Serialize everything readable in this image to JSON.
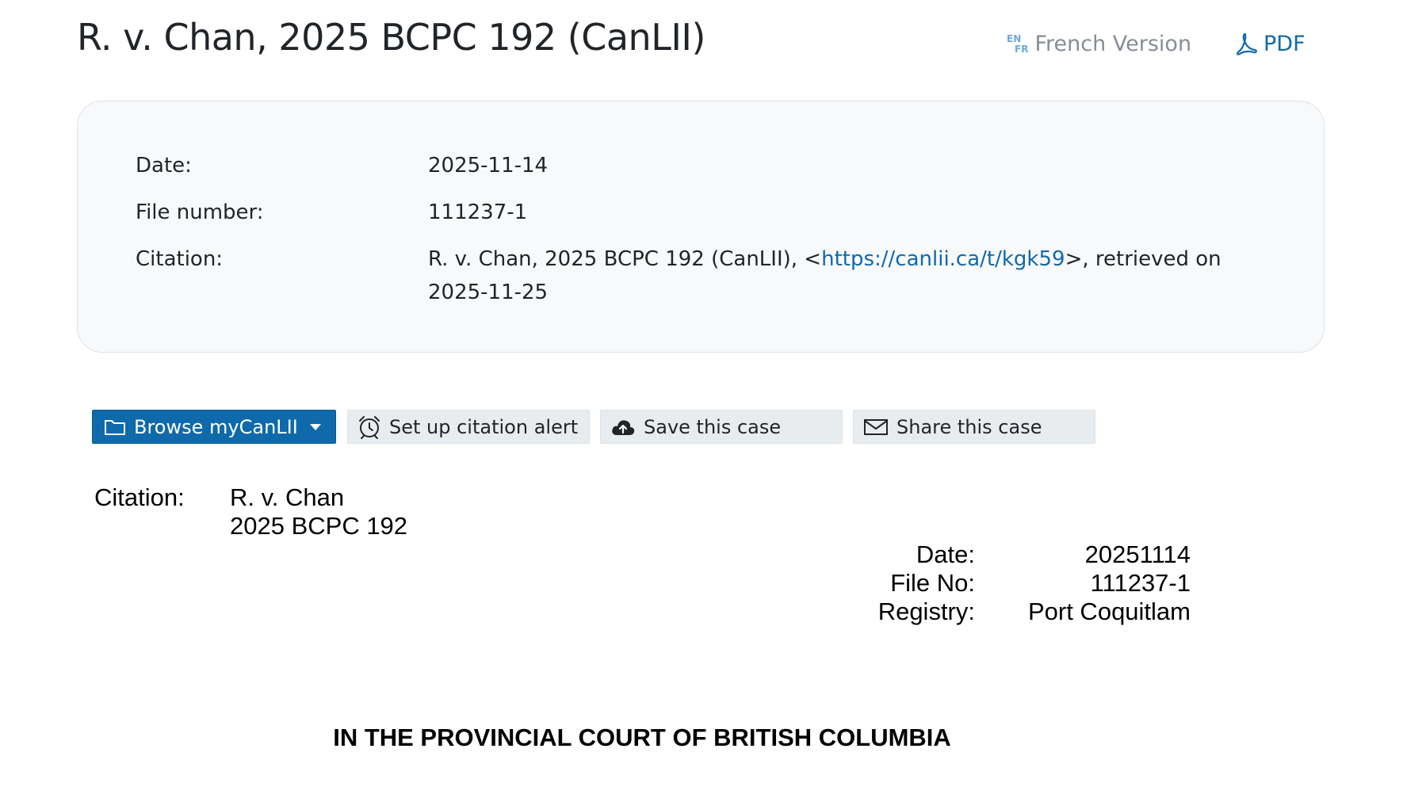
{
  "header": {
    "title": "R. v. Chan, 2025 BCPC 192 (CanLII)",
    "lang_badge_top": "EN",
    "lang_badge_bottom": "FR",
    "french_version_label": "French Version",
    "pdf_label": "PDF"
  },
  "metadata": {
    "date_label": "Date:",
    "date_value": "2025-11-14",
    "file_number_label": "File number:",
    "file_number_value": "111237-1",
    "citation_label": "Citation:",
    "citation_prefix": "R. v. Chan, 2025 BCPC 192 (CanLII), <",
    "citation_url": "https://canlii.ca/t/kgk59",
    "citation_suffix": ">, retrieved on 2025-11-25"
  },
  "toolbar": {
    "browse_label": "Browse myCanLII",
    "alert_label": "Set up citation alert",
    "save_label": "Save this case",
    "share_label": "Share this case"
  },
  "document": {
    "citation_label": "Citation:",
    "citation_name": "R. v. Chan",
    "citation_number": "2025 BCPC 192",
    "info": [
      {
        "label": "Date:",
        "value": "20251114"
      },
      {
        "label": "File No:",
        "value": "111237-1"
      },
      {
        "label": "Registry:",
        "value": "Port Coquitlam"
      }
    ],
    "court_heading": "IN THE PROVINCIAL COURT OF BRITISH COLUMBIA"
  },
  "colors": {
    "link": "#0f6aab",
    "primary_button": "#0f6aab",
    "secondary_button": "#e9ecef",
    "card_background": "#f8f9fa"
  },
  "icons": [
    "en-fr-badge-icon",
    "pdf-icon",
    "folder-icon",
    "caret-down-icon",
    "alarm-clock-icon",
    "cloud-upload-icon",
    "envelope-icon"
  ]
}
